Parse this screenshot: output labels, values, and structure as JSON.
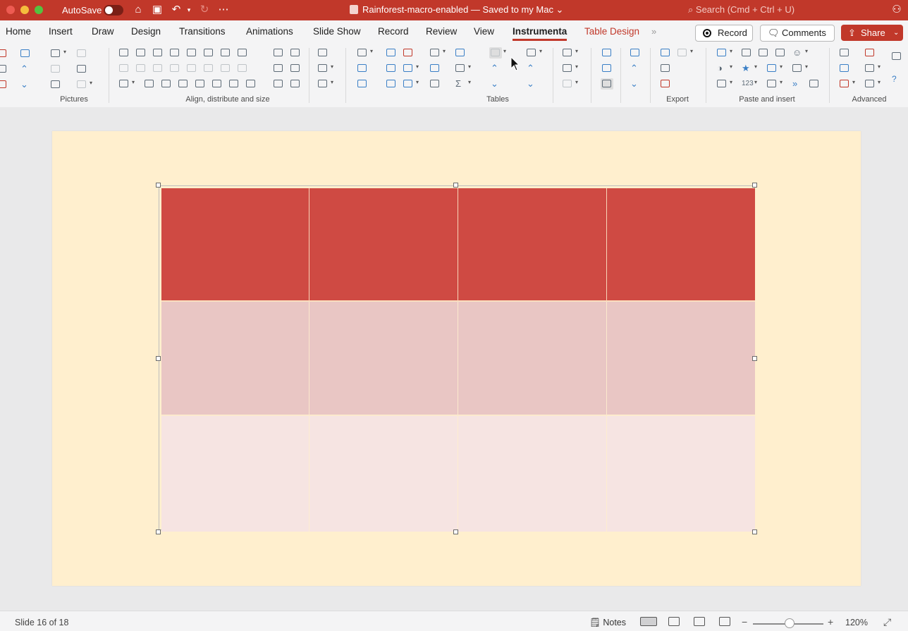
{
  "window": {
    "autosave_label": "AutoSave",
    "doc_title": "Rainforest-macro-enabled — Saved to my Mac ⌄",
    "search_placeholder": "Search (Cmd + Ctrl + U)"
  },
  "tabs": [
    {
      "label": "Home"
    },
    {
      "label": "Insert"
    },
    {
      "label": "Draw"
    },
    {
      "label": "Design"
    },
    {
      "label": "Transitions"
    },
    {
      "label": "Animations"
    },
    {
      "label": "Slide Show"
    },
    {
      "label": "Record"
    },
    {
      "label": "Review"
    },
    {
      "label": "View"
    },
    {
      "label": "Instrumenta",
      "active": true
    },
    {
      "label": "Table Design",
      "contextual": true
    }
  ],
  "header_buttons": {
    "record": "Record",
    "comments": "Comments",
    "share": "Share"
  },
  "ribbon_groups": [
    {
      "label": "Pictures"
    },
    {
      "label": "Align, distribute and size"
    },
    {
      "label": "Tables"
    },
    {
      "label": "Export"
    },
    {
      "label": "Paste and insert"
    },
    {
      "label": "Advanced"
    }
  ],
  "colors": {
    "brand": "#c1382a",
    "slide_bg": "#ffefce",
    "table_header": "#cf4a43",
    "table_row2": "#e9c6c4",
    "table_row3": "#f6e4e2"
  },
  "status": {
    "slide_counter": "Slide 16 of 18",
    "notes_label": "Notes",
    "zoom": "120%"
  }
}
